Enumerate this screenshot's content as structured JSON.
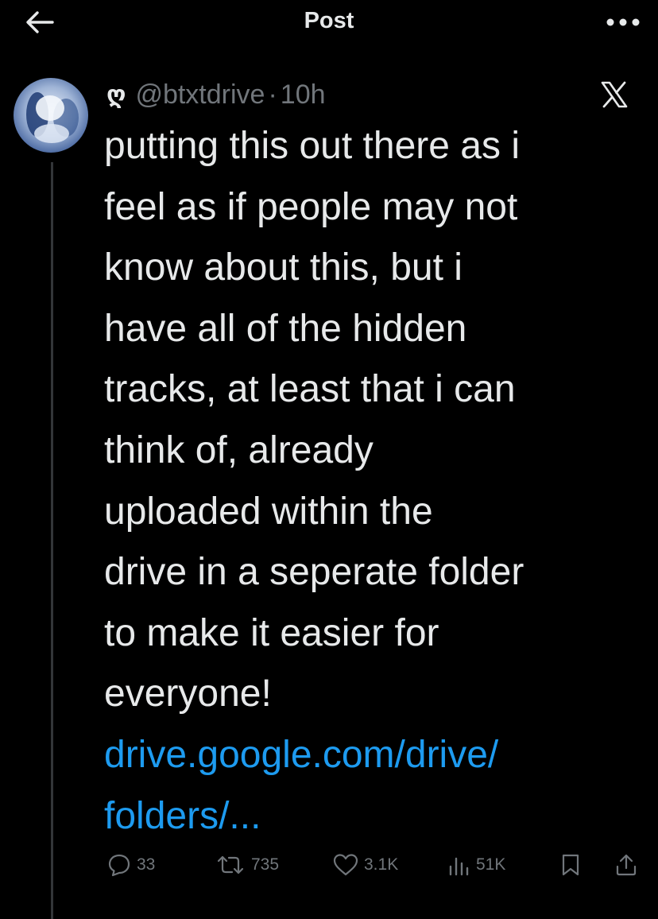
{
  "header": {
    "title": "Post",
    "back_icon": "arrow-left-icon",
    "more_icon": "more-horizontal-icon"
  },
  "post": {
    "display_name": "ღ",
    "handle": "@btxtdrive",
    "separator": "·",
    "time": "10h",
    "source_icon": "x-logo-icon",
    "text_lines": [
      "putting this out there as i",
      "feel as if people may not",
      "know about this, but i",
      "have all of the hidden",
      "tracks, at least that i can",
      "think of, already",
      "uploaded within the",
      "drive in a seperate folder",
      "to make it easier for",
      "everyone!"
    ],
    "link_lines": [
      "drive.google.com/drive/",
      "folders/..."
    ]
  },
  "actions": {
    "replies": "33",
    "reposts": "735",
    "likes": "3.1K",
    "views": "51K"
  },
  "colors": {
    "background": "#000000",
    "text": "#e7e9ea",
    "muted": "#71767b",
    "link": "#1d9bf0",
    "thread_line": "#333639"
  }
}
